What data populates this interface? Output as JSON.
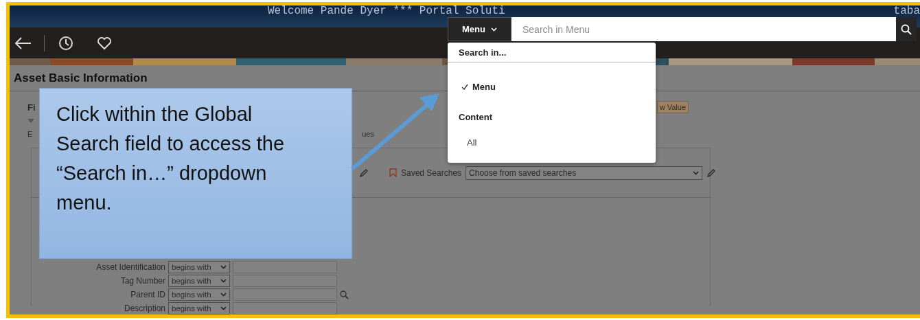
{
  "header": {
    "welcome": "Welcome Pande Dyer *** Portal Soluti",
    "right_fragment": "taba"
  },
  "global_search": {
    "scope_button": "Menu",
    "placeholder": "Search in Menu",
    "dropdown": {
      "heading": "Search in...",
      "items": [
        {
          "kind": "option",
          "label": "Menu",
          "selected": true
        },
        {
          "kind": "group",
          "label": "Content"
        },
        {
          "kind": "option",
          "label": "All",
          "selected": false
        }
      ]
    }
  },
  "page": {
    "title": "Asset Basic Information",
    "fragments": [
      "Fi",
      "E",
      "ues"
    ],
    "tag": "w Value",
    "saved_searches": {
      "label": "Saved Searches",
      "placeholder": "Choose from saved searches"
    },
    "criteria": [
      {
        "label": "Asset Identification",
        "operator": "begins with",
        "lookup": false
      },
      {
        "label": "Tag Number",
        "operator": "begins with",
        "lookup": false
      },
      {
        "label": "Parent ID",
        "operator": "begins with",
        "lookup": true
      },
      {
        "label": "Description",
        "operator": "begins with",
        "lookup": false
      }
    ]
  },
  "callout": {
    "text": "Click within the Global Search field to access the “Search in…” dropdown menu."
  }
}
